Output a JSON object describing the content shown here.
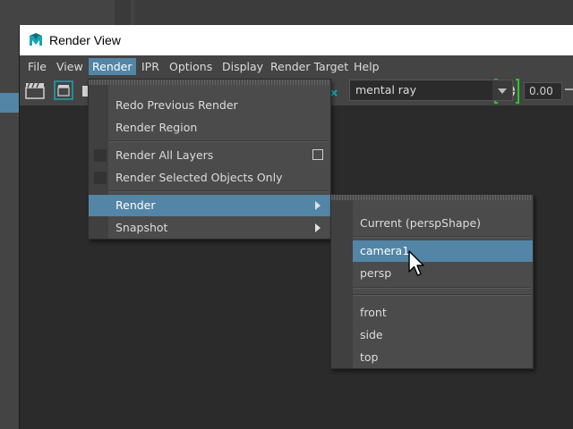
{
  "window": {
    "title": "Render View"
  },
  "menubar": {
    "items": [
      {
        "label": "File"
      },
      {
        "label": "View"
      },
      {
        "label": "Render"
      },
      {
        "label": "IPR"
      },
      {
        "label": "Options"
      },
      {
        "label": "Display"
      },
      {
        "label": "Render Target"
      },
      {
        "label": "Help"
      }
    ]
  },
  "toolbar": {
    "renderer_selected": "mental ray",
    "value_field": "0.00"
  },
  "render_menu": {
    "items": {
      "redo_previous": "Redo Previous Render",
      "render_region": "Render Region",
      "render_all_layers": "Render All Layers",
      "render_selected": "Render Selected Objects Only",
      "render": "Render",
      "snapshot": "Snapshot"
    }
  },
  "render_submenu": {
    "current": "Current (perspShape)",
    "cameras": [
      "camera1",
      "persp"
    ],
    "ortho": [
      "front",
      "side",
      "top"
    ]
  },
  "colors": {
    "highlight": "#5285a6",
    "menu_bg": "#4b4b4b",
    "window_bg": "#2b2b2b",
    "accent_green": "#22cc22",
    "icon_teal": "#17a5b3"
  },
  "icons": [
    "maya-logo-icon",
    "clapper-icon",
    "render-region-icon",
    "snapshot-icon",
    "camera-aperture-icon",
    "close-x-icon",
    "cursor-arrow-icon"
  ]
}
